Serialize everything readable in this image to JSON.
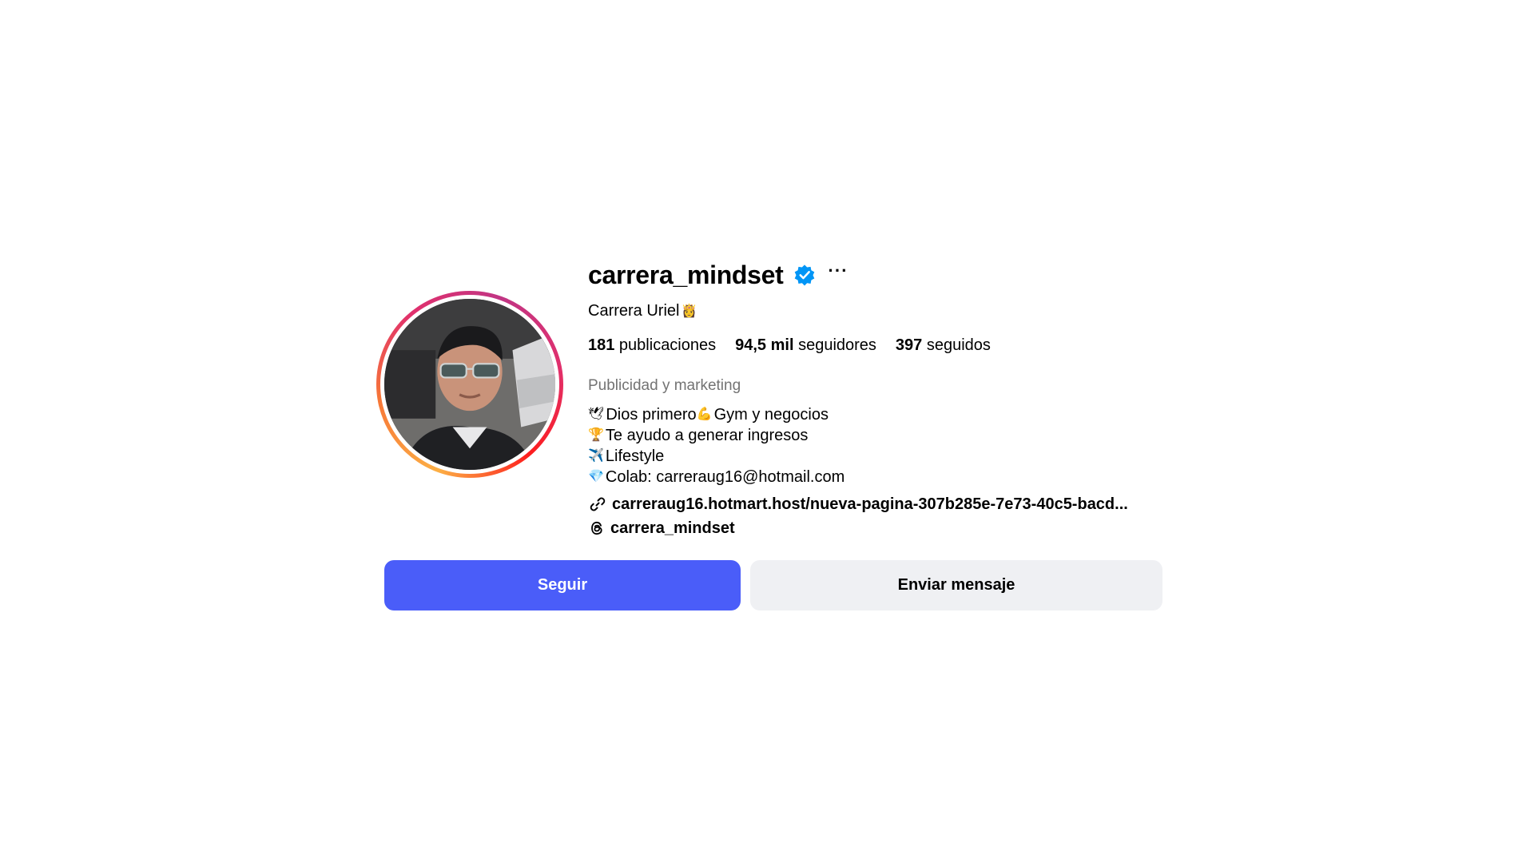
{
  "profile": {
    "username": "carrera_mindset",
    "verified": true,
    "more_label": "···",
    "full_name": "Carrera Uriel",
    "full_name_emoji": "👸",
    "stats": [
      {
        "value": "181",
        "label": " publicaciones"
      },
      {
        "value": "94,5 mil",
        "label": " seguidores"
      },
      {
        "value": "397",
        "label": " seguidos"
      }
    ],
    "category": "Publicidad y marketing",
    "bio": [
      {
        "emoji": "🕊",
        "text": "Dios primero ",
        "emoji2": "💪",
        "text2": "Gym y negocios"
      },
      {
        "emoji": "🏆",
        "text": "Te ayudo a generar ingresos"
      },
      {
        "emoji": "✈️",
        "text": "Lifestyle"
      },
      {
        "emoji": "💎",
        "text": " Colab: carreraug16@hotmail.com"
      }
    ],
    "link": "carreraug16.hotmart.host/nueva-pagina-307b285e-7e73-40c5-bacd...",
    "threads_handle": "carrera_mindset",
    "icons": {
      "verified": "verified-badge-icon",
      "link": "link-icon",
      "threads": "threads-icon"
    }
  },
  "actions": {
    "follow_label": "Seguir",
    "message_label": "Enviar mensaje"
  },
  "colors": {
    "follow_button": "#4a5df9",
    "message_button": "#eff0f3",
    "verified_badge": "#0095f6",
    "category_text": "#737373"
  }
}
